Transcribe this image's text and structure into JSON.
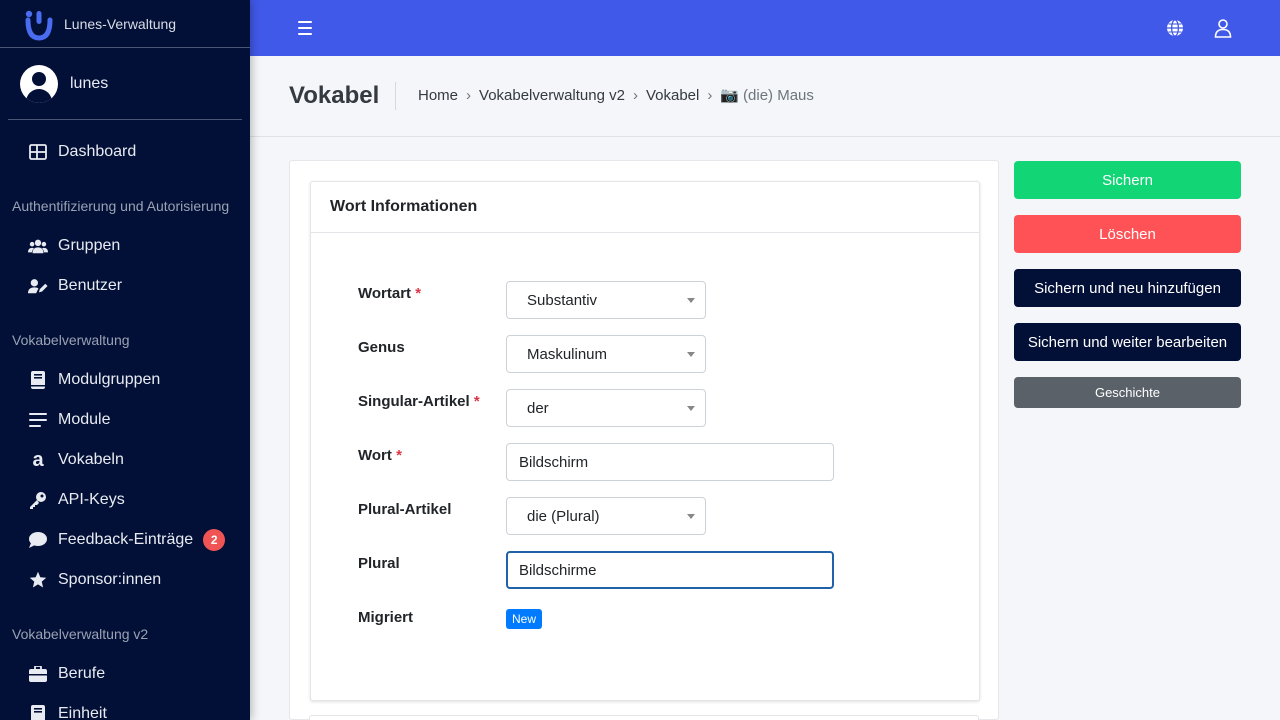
{
  "brand": {
    "name": "Lunes-Verwaltung"
  },
  "user": {
    "name": "lunes"
  },
  "sidebar": {
    "dashboard": "Dashboard",
    "section1": "Authentifizierung und Autorisierung",
    "gruppen": "Gruppen",
    "benutzer": "Benutzer",
    "section2": "Vokabelverwaltung",
    "modulgruppen": "Modulgruppen",
    "module": "Module",
    "vokabeln": "Vokabeln",
    "api_keys": "API-Keys",
    "feedback": "Feedback-Einträge",
    "feedback_count": "2",
    "sponsoren": "Sponsor:innen",
    "section3": "Vokabelverwaltung v2",
    "berufe": "Berufe",
    "einheit": "Einheit"
  },
  "header": {
    "title": "Vokabel",
    "breadcrumb": [
      "Home",
      "Vokabelverwaltung v2",
      "Vokabel"
    ],
    "current_icon": "📷",
    "current": "(die) Maus",
    "sep": "›"
  },
  "form": {
    "card_title": "Wort Informationen",
    "wortart_label": "Wortart",
    "wortart_value": "Substantiv",
    "genus_label": "Genus",
    "genus_value": "Maskulinum",
    "singular_artikel_label": "Singular-Artikel",
    "singular_artikel_value": "der",
    "wort_label": "Wort",
    "wort_value": "Bildschirm",
    "plural_artikel_label": "Plural-Artikel",
    "plural_artikel_value": "die (Plural)",
    "plural_label": "Plural",
    "plural_value": "Bildschirme",
    "migriert_label": "Migriert",
    "migriert_badge": "New",
    "required_mark": "*"
  },
  "actions": {
    "save": "Sichern",
    "delete": "Löschen",
    "save_add": "Sichern und neu hinzufügen",
    "save_continue": "Sichern und weiter bearbeiten",
    "history": "Geschichte"
  },
  "colors": {
    "sidebar_bg": "#020f36",
    "topbar_bg": "#4159e8",
    "save": "#12d676",
    "delete": "#ff5256",
    "history": "#5a6169"
  }
}
